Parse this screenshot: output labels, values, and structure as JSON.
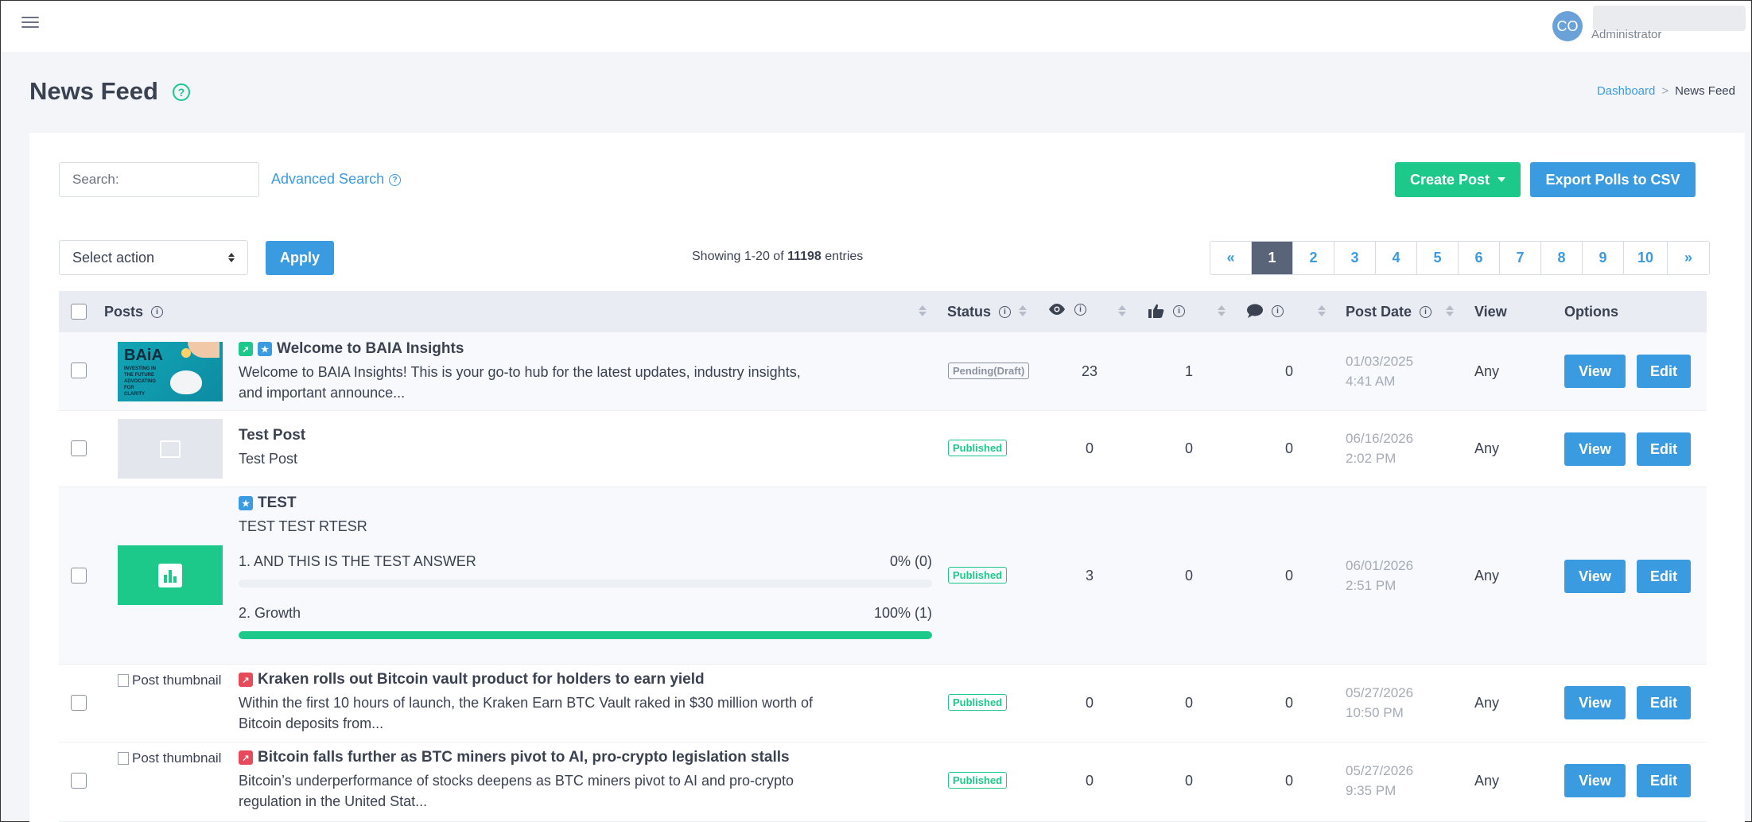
{
  "header": {
    "user_initials": "CO",
    "user_role": "Administrator"
  },
  "page": {
    "title": "News Feed",
    "breadcrumb": [
      "Dashboard",
      "News Feed"
    ]
  },
  "toolbar": {
    "search_placeholder": "Search:",
    "advanced_search": "Advanced Search",
    "create_post": "Create Post",
    "export_polls": "Export Polls to CSV",
    "select_action": "Select action",
    "apply": "Apply"
  },
  "summary": {
    "prefix": "Showing 1-20 of",
    "total": "11198",
    "suffix": "entries"
  },
  "pagination": [
    "«",
    "1",
    "2",
    "3",
    "4",
    "5",
    "6",
    "7",
    "8",
    "9",
    "10",
    "»"
  ],
  "pagination_active": "1",
  "table": {
    "headers": {
      "posts": "Posts",
      "status": "Status",
      "post_date": "Post Date",
      "view": "View",
      "options": "Options"
    },
    "rows": [
      {
        "title": "Welcome to BAIA Insights",
        "excerpt": "Welcome to BAIA Insights! This is your go-to hub for the latest updates, industry insights, and important announce...",
        "thumb_text": "BAiA",
        "thumb_sub": "INVESTING IN THE FUTURE ADVOCATING FOR CLARITY",
        "status": "Pending(Draft)",
        "views": "23",
        "likes": "1",
        "comments": "0",
        "date": "01/03/2025",
        "time": "4:41 AM",
        "view": "Any",
        "view_btn": "View",
        "edit_btn": "Edit"
      },
      {
        "title": "Test Post",
        "excerpt": "Test Post",
        "status": "Published",
        "views": "0",
        "likes": "0",
        "comments": "0",
        "date": "06/16/2026",
        "time": "2:02 PM",
        "view": "Any",
        "view_btn": "View",
        "edit_btn": "Edit"
      },
      {
        "title": "TEST",
        "excerpt": "TEST TEST RTESR",
        "poll": [
          {
            "label": "1. AND THIS IS THE TEST ANSWER",
            "result": "0% (0)",
            "percent": 0
          },
          {
            "label": "2. Growth",
            "result": "100% (1)",
            "percent": 100
          }
        ],
        "status": "Published",
        "views": "3",
        "likes": "0",
        "comments": "0",
        "date": "06/01/2026",
        "time": "2:51 PM",
        "view": "Any",
        "view_btn": "View",
        "edit_btn": "Edit"
      },
      {
        "title": "Kraken rolls out Bitcoin vault product for holders to earn yield",
        "excerpt": "Within the first 10 hours of launch, the Kraken Earn BTC Vault raked in $30 million worth of Bitcoin deposits from...",
        "thumb_alt": "Post thumbnail",
        "status": "Published",
        "views": "0",
        "likes": "0",
        "comments": "0",
        "date": "05/27/2026",
        "time": "10:50 PM",
        "view": "Any",
        "view_btn": "View",
        "edit_btn": "Edit"
      },
      {
        "title": "Bitcoin falls further as BTC miners pivot to AI, pro-crypto legislation stalls",
        "excerpt": "Bitcoin’s underperformance of stocks deepens as BTC miners pivot to AI and pro-crypto regulation in the United Stat...",
        "thumb_alt": "Post thumbnail",
        "status": "Published",
        "views": "0",
        "likes": "0",
        "comments": "0",
        "date": "05/27/2026",
        "time": "9:35 PM",
        "view": "Any",
        "view_btn": "View",
        "edit_btn": "Edit"
      }
    ]
  },
  "colors": {
    "primary": "#3b9be0",
    "success": "#1cc88a",
    "danger": "#e74a5a",
    "muted": "#a4abb6"
  }
}
